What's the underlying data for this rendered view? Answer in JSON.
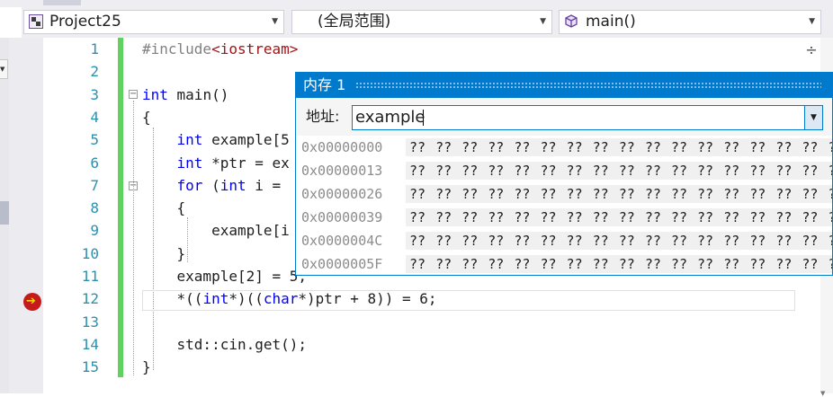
{
  "nav": {
    "project": "Project25",
    "scope": "(全局范围)",
    "function": "main()"
  },
  "editor": {
    "line_numbers": [
      "1",
      "2",
      "3",
      "4",
      "5",
      "6",
      "7",
      "8",
      "9",
      "10",
      "11",
      "12",
      "13",
      "14",
      "15"
    ],
    "lines": [
      [
        {
          "t": "#include",
          "c": "pp"
        },
        {
          "t": "<iostream>",
          "c": "inc"
        }
      ],
      [],
      [
        {
          "t": "int",
          "c": "kw"
        },
        {
          "t": " main()",
          "c": ""
        }
      ],
      [
        {
          "t": "{",
          "c": ""
        }
      ],
      [
        {
          "t": "    ",
          "c": ""
        },
        {
          "t": "int",
          "c": "kw"
        },
        {
          "t": " example[5",
          "c": ""
        }
      ],
      [
        {
          "t": "    ",
          "c": ""
        },
        {
          "t": "int",
          "c": "kw"
        },
        {
          "t": " *ptr = ex",
          "c": ""
        }
      ],
      [
        {
          "t": "    ",
          "c": ""
        },
        {
          "t": "for",
          "c": "kw"
        },
        {
          "t": " (",
          "c": ""
        },
        {
          "t": "int",
          "c": "kw"
        },
        {
          "t": " i = ",
          "c": ""
        }
      ],
      [
        {
          "t": "    {",
          "c": ""
        }
      ],
      [
        {
          "t": "        example[i",
          "c": ""
        }
      ],
      [
        {
          "t": "    }",
          "c": ""
        }
      ],
      [
        {
          "t": "    example[2] = 5;",
          "c": ""
        }
      ],
      [
        {
          "t": "    *((",
          "c": ""
        },
        {
          "t": "int",
          "c": "kw"
        },
        {
          "t": "*)((",
          "c": ""
        },
        {
          "t": "char",
          "c": "kw"
        },
        {
          "t": "*)ptr + 8)) = 6;",
          "c": ""
        }
      ],
      [],
      [
        {
          "t": "    std::cin.get();",
          "c": ""
        }
      ],
      [
        {
          "t": "}",
          "c": ""
        }
      ]
    ],
    "current_line": "12"
  },
  "memory": {
    "title": "内存 1",
    "address_label": "地址:",
    "address_value": "example",
    "rows": [
      {
        "addr": "0x00000000",
        "bytes": "?? ?? ?? ?? ?? ?? ?? ?? ?? ?? ?? ?? ?? ?? ?? ?? ??"
      },
      {
        "addr": "0x00000013",
        "bytes": "?? ?? ?? ?? ?? ?? ?? ?? ?? ?? ?? ?? ?? ?? ?? ?? ??"
      },
      {
        "addr": "0x00000026",
        "bytes": "?? ?? ?? ?? ?? ?? ?? ?? ?? ?? ?? ?? ?? ?? ?? ?? ??"
      },
      {
        "addr": "0x00000039",
        "bytes": "?? ?? ?? ?? ?? ?? ?? ?? ?? ?? ?? ?? ?? ?? ?? ?? ??"
      },
      {
        "addr": "0x0000004C",
        "bytes": "?? ?? ?? ?? ?? ?? ?? ?? ?? ?? ?? ?? ?? ?? ?? ?? ??"
      },
      {
        "addr": "0x0000005F",
        "bytes": "?? ?? ?? ?? ?? ?? ?? ?? ?? ?? ?? ?? ?? ?? ?? ?? ??"
      }
    ]
  },
  "icons": {
    "project": "project-icon",
    "function": "cube-icon",
    "breakpoint": "breakpoint-current-line-icon",
    "splitter": "split-window-icon"
  },
  "colors": {
    "accent": "#007acc",
    "keyword": "#0000ff",
    "line_number": "#2b91af",
    "change_bar": "#5fd35f",
    "breakpoint": "#c51b1b"
  }
}
